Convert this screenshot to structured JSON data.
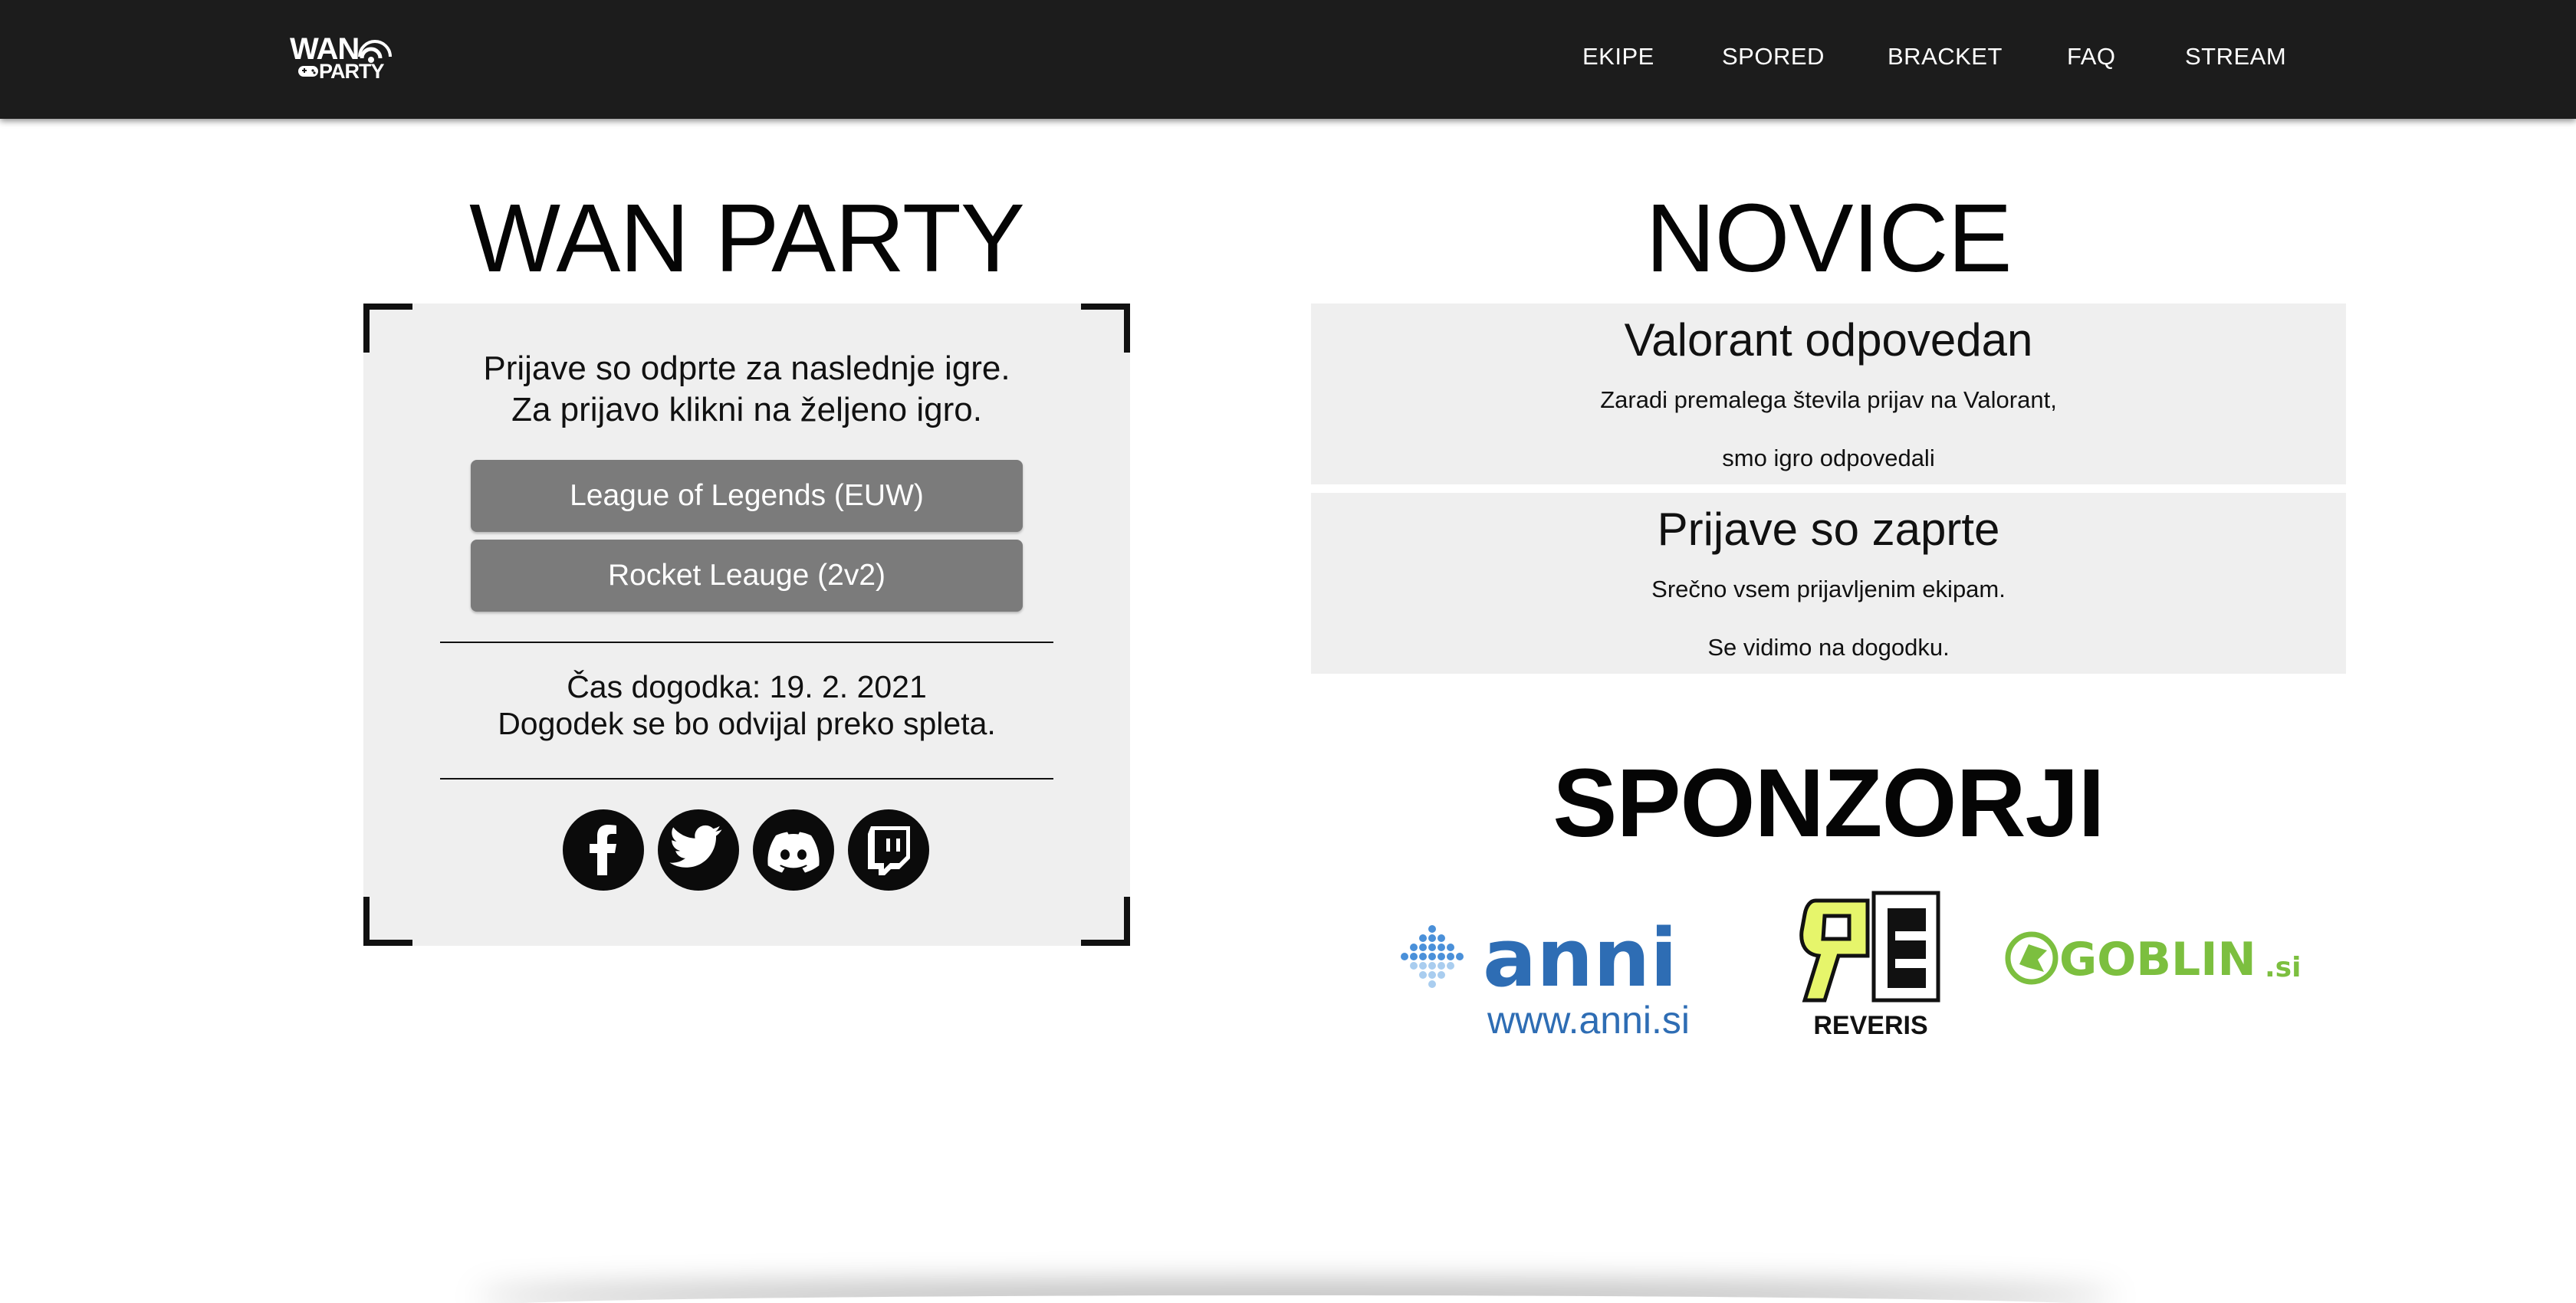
{
  "header": {
    "logo": {
      "line1": "WAN",
      "line2": "PARTY"
    },
    "nav": [
      {
        "label": "EKIPE"
      },
      {
        "label": "SPORED"
      },
      {
        "label": "BRACKET"
      },
      {
        "label": "FAQ"
      },
      {
        "label": "STREAM"
      }
    ]
  },
  "wan_party": {
    "title": "WAN PARTY",
    "intro_line1": "Prijave so odprte za naslednje igre.",
    "intro_line2": "Za prijavo klikni na željeno igro.",
    "games": [
      {
        "label": "League of Legends (EUW)"
      },
      {
        "label": "Rocket Leauge (2v2)"
      }
    ],
    "event_time": "Čas dogodka: 19. 2. 2021",
    "event_location": "Dogodek se bo odvijal preko spleta.",
    "socials": [
      "facebook-icon",
      "twitter-icon",
      "discord-icon",
      "twitch-icon"
    ]
  },
  "novice": {
    "title": "NOVICE",
    "items": [
      {
        "title": "Valorant odpovedan",
        "line1": "Zaradi premalega števila prijav na Valorant,",
        "line2": "smo igro odpovedali"
      },
      {
        "title": "Prijave so zaprte",
        "line1": "Srečno vsem prijavljenim ekipam.",
        "line2": "Se vidimo na dogodku."
      }
    ]
  },
  "sponzorji": {
    "title": "SPONZORJI",
    "sponsors": [
      {
        "name": "anni",
        "url_text": "www.anni.si",
        "color": "#2e6db4"
      },
      {
        "name": "REVERIS",
        "color": "#e6f56b"
      },
      {
        "name": "GOBLIN",
        "suffix": ".si",
        "color": "#7cbf3f"
      }
    ]
  },
  "colors": {
    "navbar": "#1c1c1c",
    "card": "#efefef",
    "button": "#7b7b7b"
  }
}
